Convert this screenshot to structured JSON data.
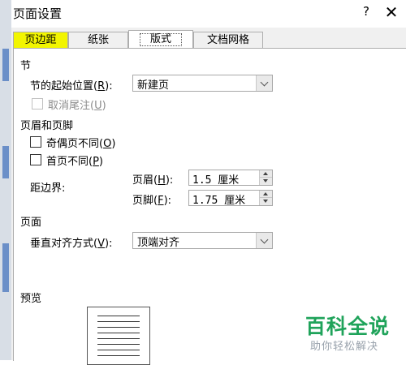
{
  "window": {
    "title": "页面设置",
    "help_label": "?",
    "close_label": "✕"
  },
  "tabs": [
    {
      "label": "页边距"
    },
    {
      "label": "纸张"
    },
    {
      "label": "版式"
    },
    {
      "label": "文档网格"
    }
  ],
  "section_start": {
    "heading": "节",
    "start_label": "节的起始位置(",
    "start_key": "R",
    "start_tail": "):",
    "start_value": "新建页",
    "suppress_label": "取消尾注(",
    "suppress_key": "U",
    "suppress_tail": ")"
  },
  "header_footer": {
    "heading": "页眉和页脚",
    "odd_even_label": "奇偶页不同(",
    "odd_even_key": "O",
    "odd_even_tail": ")",
    "first_page_label": "首页不同(",
    "first_page_key": "P",
    "first_page_tail": ")",
    "from_edge_label": "距边界:",
    "header_label": "页眉(",
    "header_key": "H",
    "header_tail": "):",
    "header_value": "1.5 厘米",
    "footer_label": "页脚(",
    "footer_key": "F",
    "footer_tail": "):",
    "footer_value": "1.75 厘米"
  },
  "page_section": {
    "heading": "页面",
    "valign_label": "垂直对齐方式(",
    "valign_key": "V",
    "valign_tail": "):",
    "valign_value": "顶端对齐"
  },
  "preview": {
    "heading": "预览"
  },
  "watermark": {
    "main": "百科全说",
    "sub": "助你轻松解决"
  },
  "colors": {
    "tab_highlight": "#f2f500",
    "watermark": "#1fa35a",
    "client_bg": "#f0f0f0"
  }
}
